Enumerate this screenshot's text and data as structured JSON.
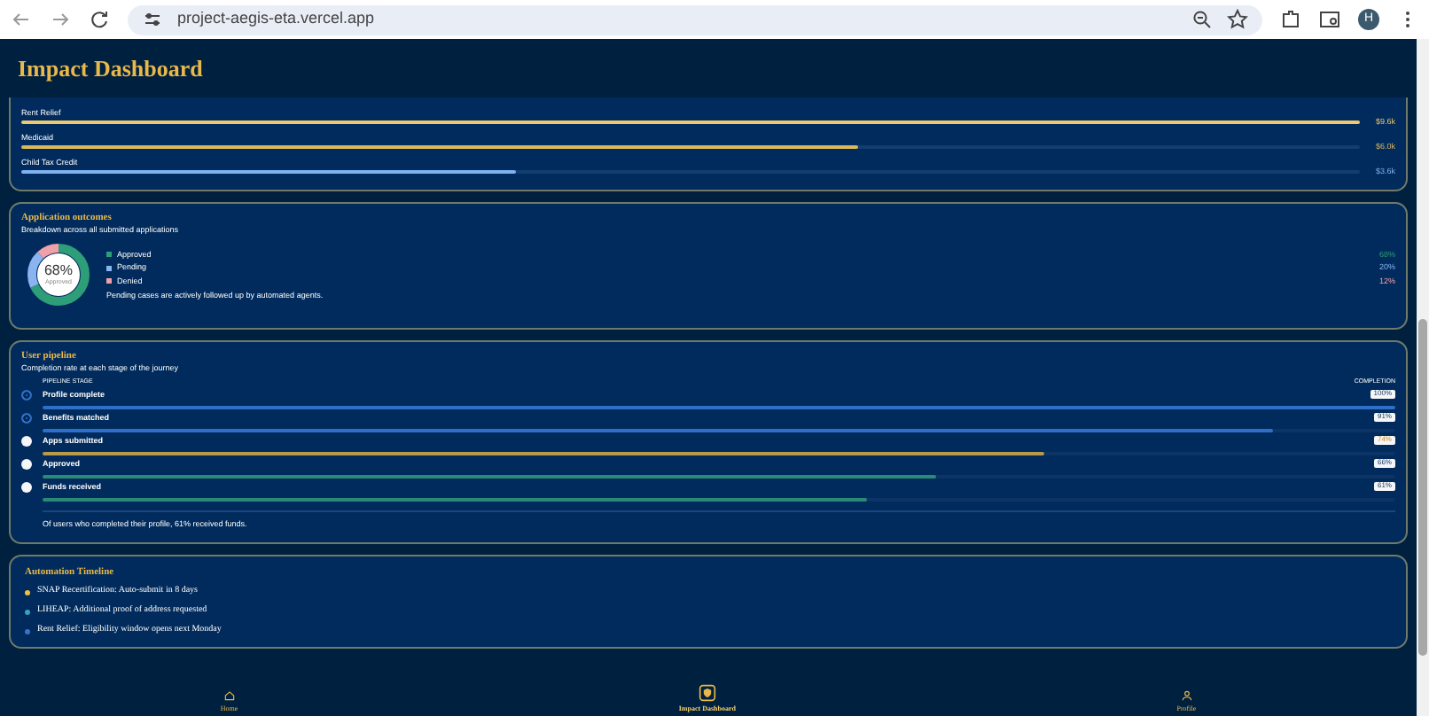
{
  "browser": {
    "url": "project-aegis-eta.vercel.app",
    "profile_initial": "H"
  },
  "header": {
    "title": "Impact Dashboard"
  },
  "benefits": {
    "rows": [
      {
        "label": "Rent Relief",
        "amount": "$9.6k",
        "level": 1.0,
        "color": "#f0c96a"
      },
      {
        "label": "Medicaid",
        "amount": "$6.0k",
        "level": 0.625,
        "color": "#d8b85a"
      },
      {
        "label": "Child Tax Credit",
        "amount": "$3.6k",
        "level": 0.37,
        "color": "#7fb2f0"
      }
    ]
  },
  "outcomes": {
    "title": "Application outcomes",
    "subtitle": "Breakdown across all submitted applications",
    "center_value": "68%",
    "center_label": "Approved",
    "note": "Pending cases are actively followed up by automated agents.",
    "items": [
      {
        "label": "Approved",
        "value": "68%",
        "color": "#2e9e78"
      },
      {
        "label": "Pending",
        "value": "20%",
        "color": "#8ab4f0"
      },
      {
        "label": "Denied",
        "value": "12%",
        "color": "#f0a0a8"
      }
    ]
  },
  "pipeline": {
    "title": "User pipeline",
    "subtitle": "Completion rate at each stage of the journey",
    "col_stage": "PIPELINE STAGE",
    "col_completion": "COMPLETION",
    "footer": "Of users who completed their profile, 61% received funds.",
    "stages": [
      {
        "label": "Profile complete",
        "value": "100%",
        "level": 1.0,
        "completed": true,
        "color": "#2f6fc8"
      },
      {
        "label": "Benefits matched",
        "value": "91%",
        "level": 0.91,
        "completed": true,
        "color": "#2f6fc8"
      },
      {
        "label": "Apps submitted",
        "value": "74%",
        "level": 0.74,
        "completed": false,
        "color": "#b89a4a"
      },
      {
        "label": "Approved",
        "value": "66%",
        "level": 0.66,
        "completed": false,
        "color": "#2a8a78"
      },
      {
        "label": "Funds received",
        "value": "61%",
        "level": 0.61,
        "completed": false,
        "color": "#2a8a78"
      }
    ]
  },
  "timeline": {
    "title": "Automation Timeline",
    "items": [
      {
        "text": "SNAP Recertification: Auto-submit in 8 days",
        "color": "#f0c040"
      },
      {
        "text": "LIHEAP: Additional proof of address requested",
        "color": "#3aa0c0"
      },
      {
        "text": "Rent Relief: Eligibility window opens next Monday",
        "color": "#3a70d0"
      }
    ]
  },
  "nav": [
    {
      "label": "Home",
      "selected": false
    },
    {
      "label": "Impact Dashboard",
      "selected": true
    },
    {
      "label": "Profile",
      "selected": false
    }
  ]
}
